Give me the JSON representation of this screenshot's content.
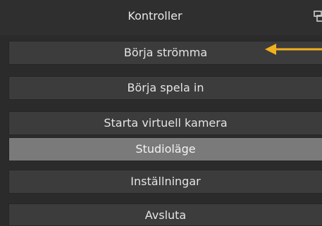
{
  "dock": {
    "title": "Kontroller"
  },
  "buttons": [
    {
      "label": "Börja strömma",
      "active": false
    },
    {
      "label": "Börja spela in",
      "active": false
    },
    {
      "label": "Starta virtuell kamera",
      "active": false
    },
    {
      "label": "Studioläge",
      "active": true
    },
    {
      "label": "Inställningar",
      "active": false
    },
    {
      "label": "Avsluta",
      "active": false
    }
  ],
  "annotation": {
    "arrow_color": "#f2b01e",
    "icon": "arrow-left-icon"
  },
  "colors": {
    "button_bg": "#3c3c3c",
    "button_active_bg": "#7a7a7a",
    "text": "#e4e4e4"
  }
}
